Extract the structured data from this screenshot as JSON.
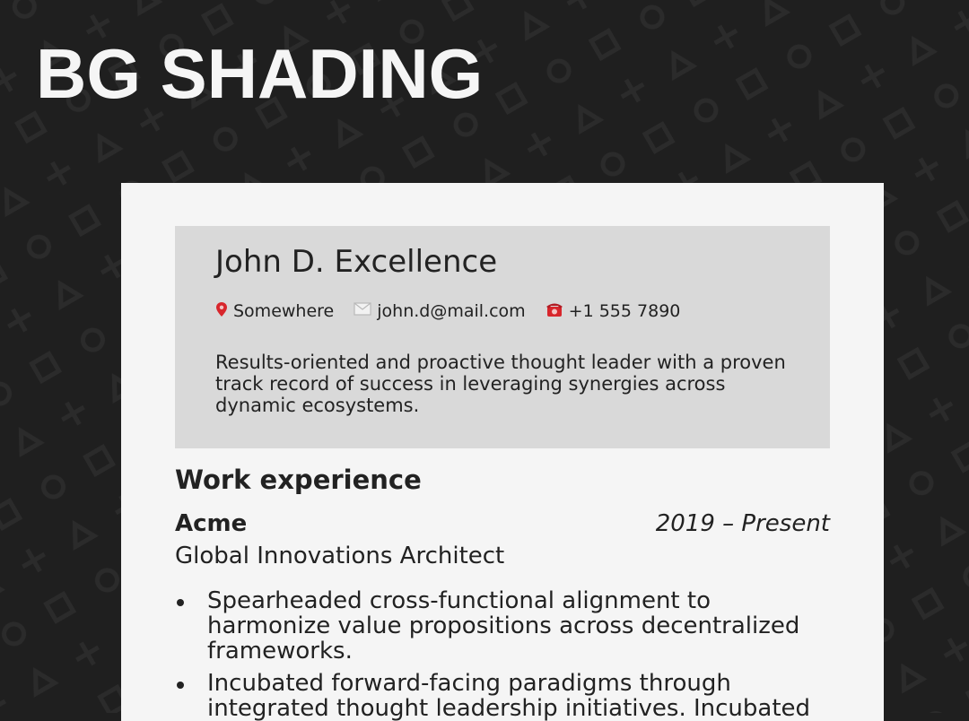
{
  "banner": {
    "title": "BG SHADING"
  },
  "resume": {
    "name": "John D. Excellence",
    "contact": {
      "location": "Somewhere",
      "email": "john.d@mail.com",
      "phone": "+1 555 7890"
    },
    "summary": "Results-oriented and proactive thought leader with a proven track record of success in leveraging synergies across dynamic ecosystems.",
    "sections": {
      "work_experience": {
        "title": "Work experience",
        "jobs": [
          {
            "company": "Acme",
            "dates": "2019 – Present",
            "role": "Global Innovations Architect",
            "bullets": [
              "Spearheaded cross-functional alignment to harmonize value propositions across decentralized frameworks.",
              "Incubated forward-facing paradigms through integrated thought leadership initiatives. Incubated"
            ]
          }
        ]
      }
    }
  },
  "icons": {
    "location": "map-pin-icon",
    "email": "envelope-icon",
    "phone": "telephone-icon"
  },
  "colors": {
    "background": "#1f1f1f",
    "paper": "#f5f5f5",
    "header_box": "#d9d9d9",
    "text": "#222222",
    "banner_text": "#f5f5f5"
  }
}
